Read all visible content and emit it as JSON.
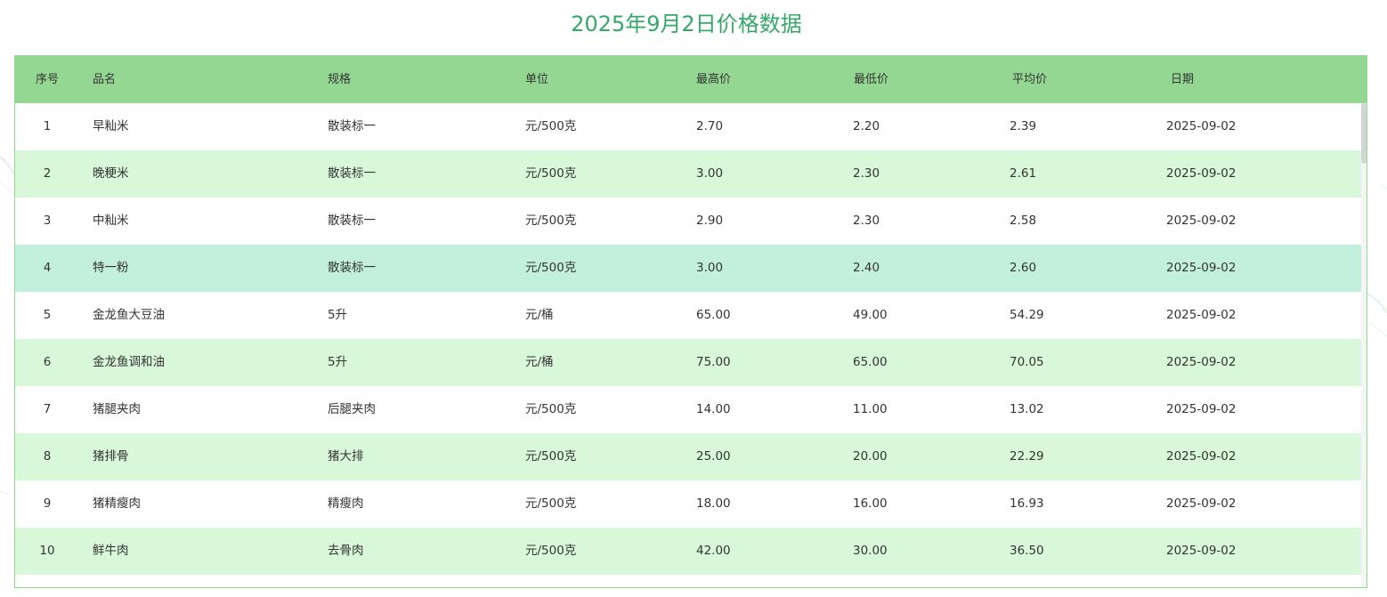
{
  "title": "2025年9月2日价格数据",
  "colors": {
    "title": "#35a868",
    "header_bg": "#93d792",
    "row_even_bg": "#d9f8da",
    "row_hover_bg": "#c3efdd",
    "border": "#93d792"
  },
  "table": {
    "headers": [
      "序号",
      "品名",
      "规格",
      "单位",
      "最高价",
      "最低价",
      "平均价",
      "日期"
    ],
    "rows": [
      [
        "1",
        "早籼米",
        "散装标一",
        "元/500克",
        "2.70",
        "2.20",
        "2.39",
        "2025-09-02"
      ],
      [
        "2",
        "晚粳米",
        "散装标一",
        "元/500克",
        "3.00",
        "2.30",
        "2.61",
        "2025-09-02"
      ],
      [
        "3",
        "中籼米",
        "散装标一",
        "元/500克",
        "2.90",
        "2.30",
        "2.58",
        "2025-09-02"
      ],
      [
        "4",
        "特一粉",
        "散装标一",
        "元/500克",
        "3.00",
        "2.40",
        "2.60",
        "2025-09-02"
      ],
      [
        "5",
        "金龙鱼大豆油",
        "5升",
        "元/桶",
        "65.00",
        "49.00",
        "54.29",
        "2025-09-02"
      ],
      [
        "6",
        "金龙鱼调和油",
        "5升",
        "元/桶",
        "75.00",
        "65.00",
        "70.05",
        "2025-09-02"
      ],
      [
        "7",
        "猪腿夹肉",
        "后腿夹肉",
        "元/500克",
        "14.00",
        "11.00",
        "13.02",
        "2025-09-02"
      ],
      [
        "8",
        "猪排骨",
        "猪大排",
        "元/500克",
        "25.00",
        "20.00",
        "22.29",
        "2025-09-02"
      ],
      [
        "9",
        "猪精瘦肉",
        "精瘦肉",
        "元/500克",
        "18.00",
        "16.00",
        "16.93",
        "2025-09-02"
      ],
      [
        "10",
        "鲜牛肉",
        "去骨肉",
        "元/500克",
        "42.00",
        "30.00",
        "36.50",
        "2025-09-02"
      ]
    ],
    "hovered_row": 4
  }
}
